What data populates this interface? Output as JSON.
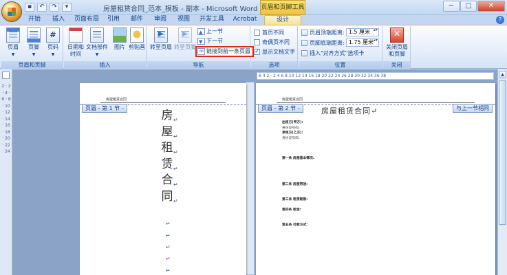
{
  "window": {
    "title": "房屋租赁合同_范本_模板 - 副本 - Microsoft Word",
    "context_tab_title": "页眉和页脚工具",
    "minimize": "─",
    "maximize": "□",
    "close": "✕"
  },
  "quick_access": {
    "save": "▪",
    "undo": "↶",
    "redo": "↷",
    "more": "▾"
  },
  "ribbon_tabs": [
    "开始",
    "插入",
    "页面布局",
    "引用",
    "邮件",
    "审阅",
    "视图",
    "开发工具",
    "Acrobat",
    "设计"
  ],
  "active_tab": "设计",
  "groups": {
    "header_footer": {
      "label": "页眉和页脚",
      "header": "页眉",
      "footer": "页脚",
      "page_number": "页码"
    },
    "insert": {
      "label": "插入",
      "date_time_1": "日期和",
      "date_time_2": "时间",
      "quick_parts": "文档部件",
      "picture": "图片",
      "clip_art": "剪贴画"
    },
    "navigation": {
      "label": "导航",
      "goto_header": "转至页眉",
      "goto_footer": "转至页脚",
      "previous": "上一节",
      "next": "下一节",
      "link_to_previous": "链接到前一条页眉"
    },
    "options": {
      "label": "选项",
      "different_first": "首页不同",
      "different_odd_even": "奇偶页不同",
      "show_doc_text": "显示文档文字"
    },
    "position": {
      "label": "位置",
      "header_top_label": "页眉顶端距离:",
      "header_top_value": "1.5 厘米",
      "footer_bottom_label": "页脚底端距离:",
      "footer_bottom_value": "1.75 厘米",
      "insert_align_tab": "插入\"对齐方式\"选项卡"
    },
    "close": {
      "label": "关闭",
      "close_btn_1": "关闭页眉",
      "close_btn_2": "和页脚"
    }
  },
  "rulers": {
    "horizontal": "6  4  2  · 2  4  6  8  10  12  14  16  18  20  22  24  26  28  30  32  34  36  38",
    "vertical": "2 · 2 · 4 · 6 · 8 · 10 · 12 · 14 · 16 · 18 · 20 · 22 · 24"
  },
  "page1": {
    "header_text": "房屋租赁合同",
    "header_tag": "页眉 - 第 1 节 -",
    "title_chars": [
      "房",
      "屋",
      "租",
      "赁",
      "合",
      "同"
    ],
    "para_mark": "↵"
  },
  "page2": {
    "header_text": "房屋租赁合同",
    "header_tag": "页眉 - 第 2 节 -",
    "same_as_previous": "与上一节相同",
    "title": "房屋租赁合同↵",
    "lines": [
      "出租方(甲方):",
      "身份证号码:",
      "承租方(乙方):",
      "身份证号码:",
      "第一条 房屋基本情况:",
      "第二条 房屋用途:",
      "第三条 租赁期限:",
      "第四条 租金:",
      "第五条 付款方式:"
    ]
  }
}
